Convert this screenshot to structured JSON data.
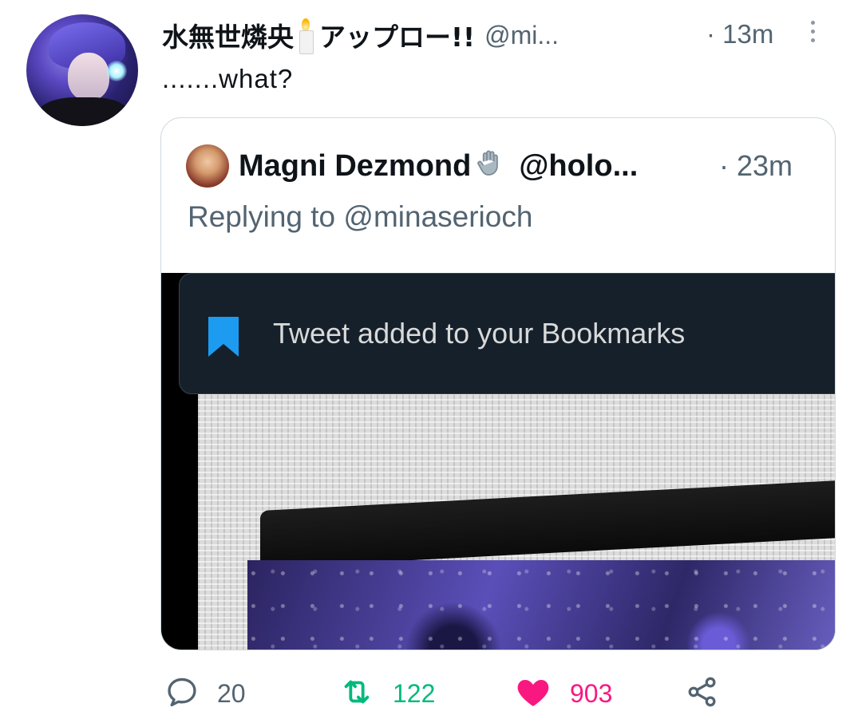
{
  "tweet": {
    "author_name": "水無世燐央",
    "author_suffix": "アップロー!!",
    "handle": "@mi...",
    "time": "· 13m",
    "text": ".......what?"
  },
  "quoted_tweet": {
    "author_name": "Magni Dezmond",
    "author_emoji_icon": "waving-hand-icon",
    "handle": "@holo...",
    "time": "· 23m",
    "replying_to": "Replying to @minaserioch",
    "media": {
      "toast_text": "Tweet added to your Bookmarks",
      "accent_color": "#1d9bf0"
    }
  },
  "actions": {
    "reply_count": "20",
    "retweet_count": "122",
    "like_count": "903"
  },
  "colors": {
    "retweet": "#00ba7c",
    "like": "#f91880",
    "secondary_text": "#536471"
  }
}
